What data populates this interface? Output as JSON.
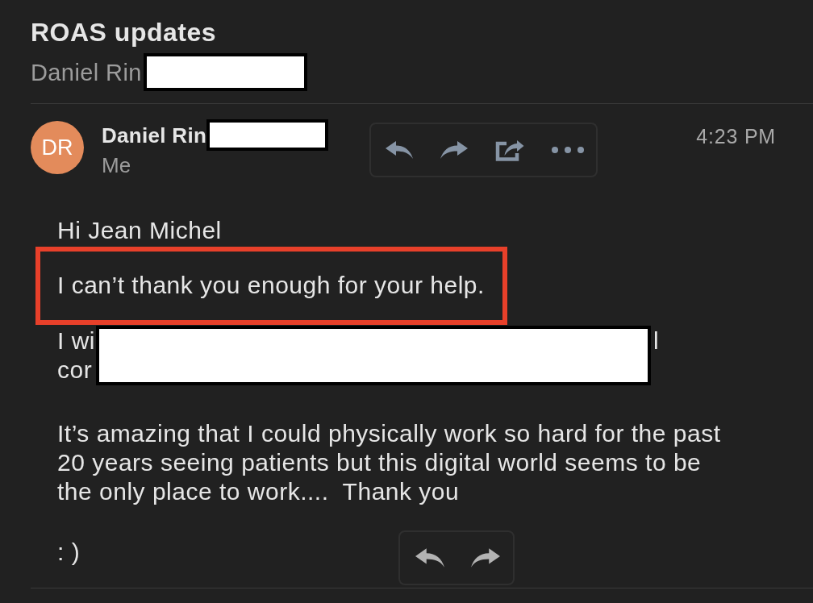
{
  "subject": "ROAS updates",
  "thread_sender": {
    "name": "Daniel Rin",
    "redacted": true
  },
  "message": {
    "avatar_initials": "DR",
    "sender": {
      "name": "Daniel Rin",
      "redacted": true
    },
    "recipient": "Me",
    "time": "4:23 PM",
    "body": [
      {
        "kind": "plain",
        "text": "Hi Jean Michel"
      },
      {
        "kind": "highlighted",
        "text": "I can’t thank you enough for your help."
      },
      {
        "kind": "redacted",
        "lines": [
          "I wi",
          "cor"
        ],
        "after": "l"
      },
      {
        "kind": "plain",
        "text": "It’s amazing that I could physically work so hard for the past\n20 years seeing patients but this digital world seems to be\nthe only place to work....  Thank you"
      }
    ],
    "closing": ": )"
  }
}
